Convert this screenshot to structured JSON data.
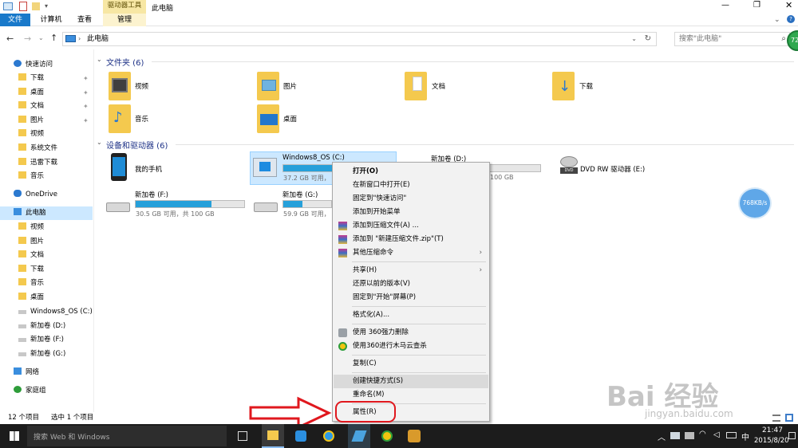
{
  "titlebar": {
    "ribbon_context": "驱动器工具",
    "title": "此电脑"
  },
  "ribbon": {
    "tabs": [
      "文件",
      "计算机",
      "查看",
      "管理"
    ]
  },
  "address": {
    "path": "此电脑",
    "search_placeholder": "搜索\"此电脑\""
  },
  "nav": {
    "items": [
      {
        "label": "快速访问",
        "pinned": false
      },
      {
        "label": "下载",
        "pinned": true
      },
      {
        "label": "桌面",
        "pinned": true
      },
      {
        "label": "文档",
        "pinned": true
      },
      {
        "label": "图片",
        "pinned": true
      },
      {
        "label": "视频",
        "pinned": false
      },
      {
        "label": "系统文件",
        "pinned": false
      },
      {
        "label": "迅雷下载",
        "pinned": false
      },
      {
        "label": "音乐",
        "pinned": false
      },
      {
        "label": "OneDrive",
        "pinned": false
      },
      {
        "label": "此电脑",
        "pinned": false
      },
      {
        "label": "视频",
        "pinned": false
      },
      {
        "label": "图片",
        "pinned": false
      },
      {
        "label": "文档",
        "pinned": false
      },
      {
        "label": "下载",
        "pinned": false
      },
      {
        "label": "音乐",
        "pinned": false
      },
      {
        "label": "桌面",
        "pinned": false
      },
      {
        "label": "Windows8_OS (C:)",
        "pinned": false
      },
      {
        "label": "新加卷 (D:)",
        "pinned": false
      },
      {
        "label": "新加卷 (F:)",
        "pinned": false
      },
      {
        "label": "新加卷 (G:)",
        "pinned": false
      },
      {
        "label": "网络",
        "pinned": false
      },
      {
        "label": "家庭组",
        "pinned": false
      }
    ]
  },
  "folders": {
    "header": "文件夹 (6)",
    "items": [
      "视频",
      "图片",
      "文档",
      "下载",
      "音乐",
      "桌面"
    ]
  },
  "devices": {
    "header": "设备和驱动器 (6)",
    "phone": "我的手机",
    "drives": [
      {
        "name": "Windows8_OS (C:)",
        "info": "37.2 GB 可用，",
        "used": 0.62
      },
      {
        "name": "新加卷 (D:)",
        "info": "100 GB",
        "used": 0.1
      },
      {
        "name": "DVD RW 驱动器 (E:)",
        "info": "",
        "used": 0
      },
      {
        "name": "新加卷 (F:)",
        "info": "30.5 GB 可用，共 100 GB",
        "used": 0.7
      },
      {
        "name": "新加卷 (G:)",
        "info": "59.9 GB 可用，",
        "used": 0.4
      }
    ]
  },
  "speed": "768KB/s",
  "badge": "72",
  "status": {
    "count": "12 个项目",
    "selected": "选中 1 个项目"
  },
  "context_menu": {
    "items": [
      "打开(O)",
      "在新窗口中打开(E)",
      "固定到\"快速访问\"",
      "添加到开始菜单",
      "添加到压缩文件(A) ...",
      "添加到 \"新建压缩文件.zip\"(T)",
      "其他压缩命令",
      "共享(H)",
      "还原以前的版本(V)",
      "固定到\"开始\"屏幕(P)",
      "格式化(A)...",
      "使用 360强力删除",
      "使用360进行木马云查杀",
      "复制(C)",
      "创建快捷方式(S)",
      "重命名(M)",
      "属性(R)"
    ]
  },
  "taskbar": {
    "search": "搜索 Web 和 Windows",
    "time": "21:47",
    "date": "2015/8/20",
    "ime": "中"
  },
  "watermark": {
    "brand": "Bai 经验",
    "url": "jingyan.baidu.com"
  }
}
